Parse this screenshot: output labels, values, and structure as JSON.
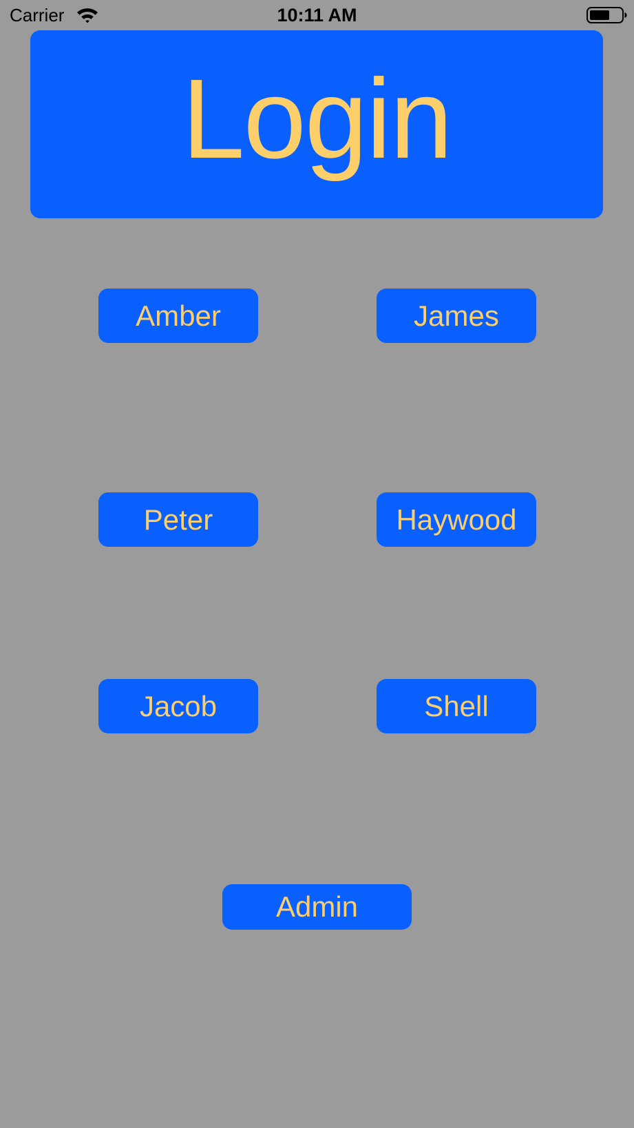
{
  "status_bar": {
    "carrier": "Carrier",
    "time": "10:11 AM",
    "wifi_icon": "wifi-icon",
    "battery_icon": "battery-icon"
  },
  "header": {
    "title": "Login"
  },
  "users": {
    "amber": "Amber",
    "james": "James",
    "peter": "Peter",
    "haywood": "Haywood",
    "jacob": "Jacob",
    "shell": "Shell"
  },
  "admin": {
    "label": "Admin"
  },
  "colors": {
    "background": "#9b9b9b",
    "button_blue": "#0a60ff",
    "label_yellow": "#fccf6b"
  }
}
